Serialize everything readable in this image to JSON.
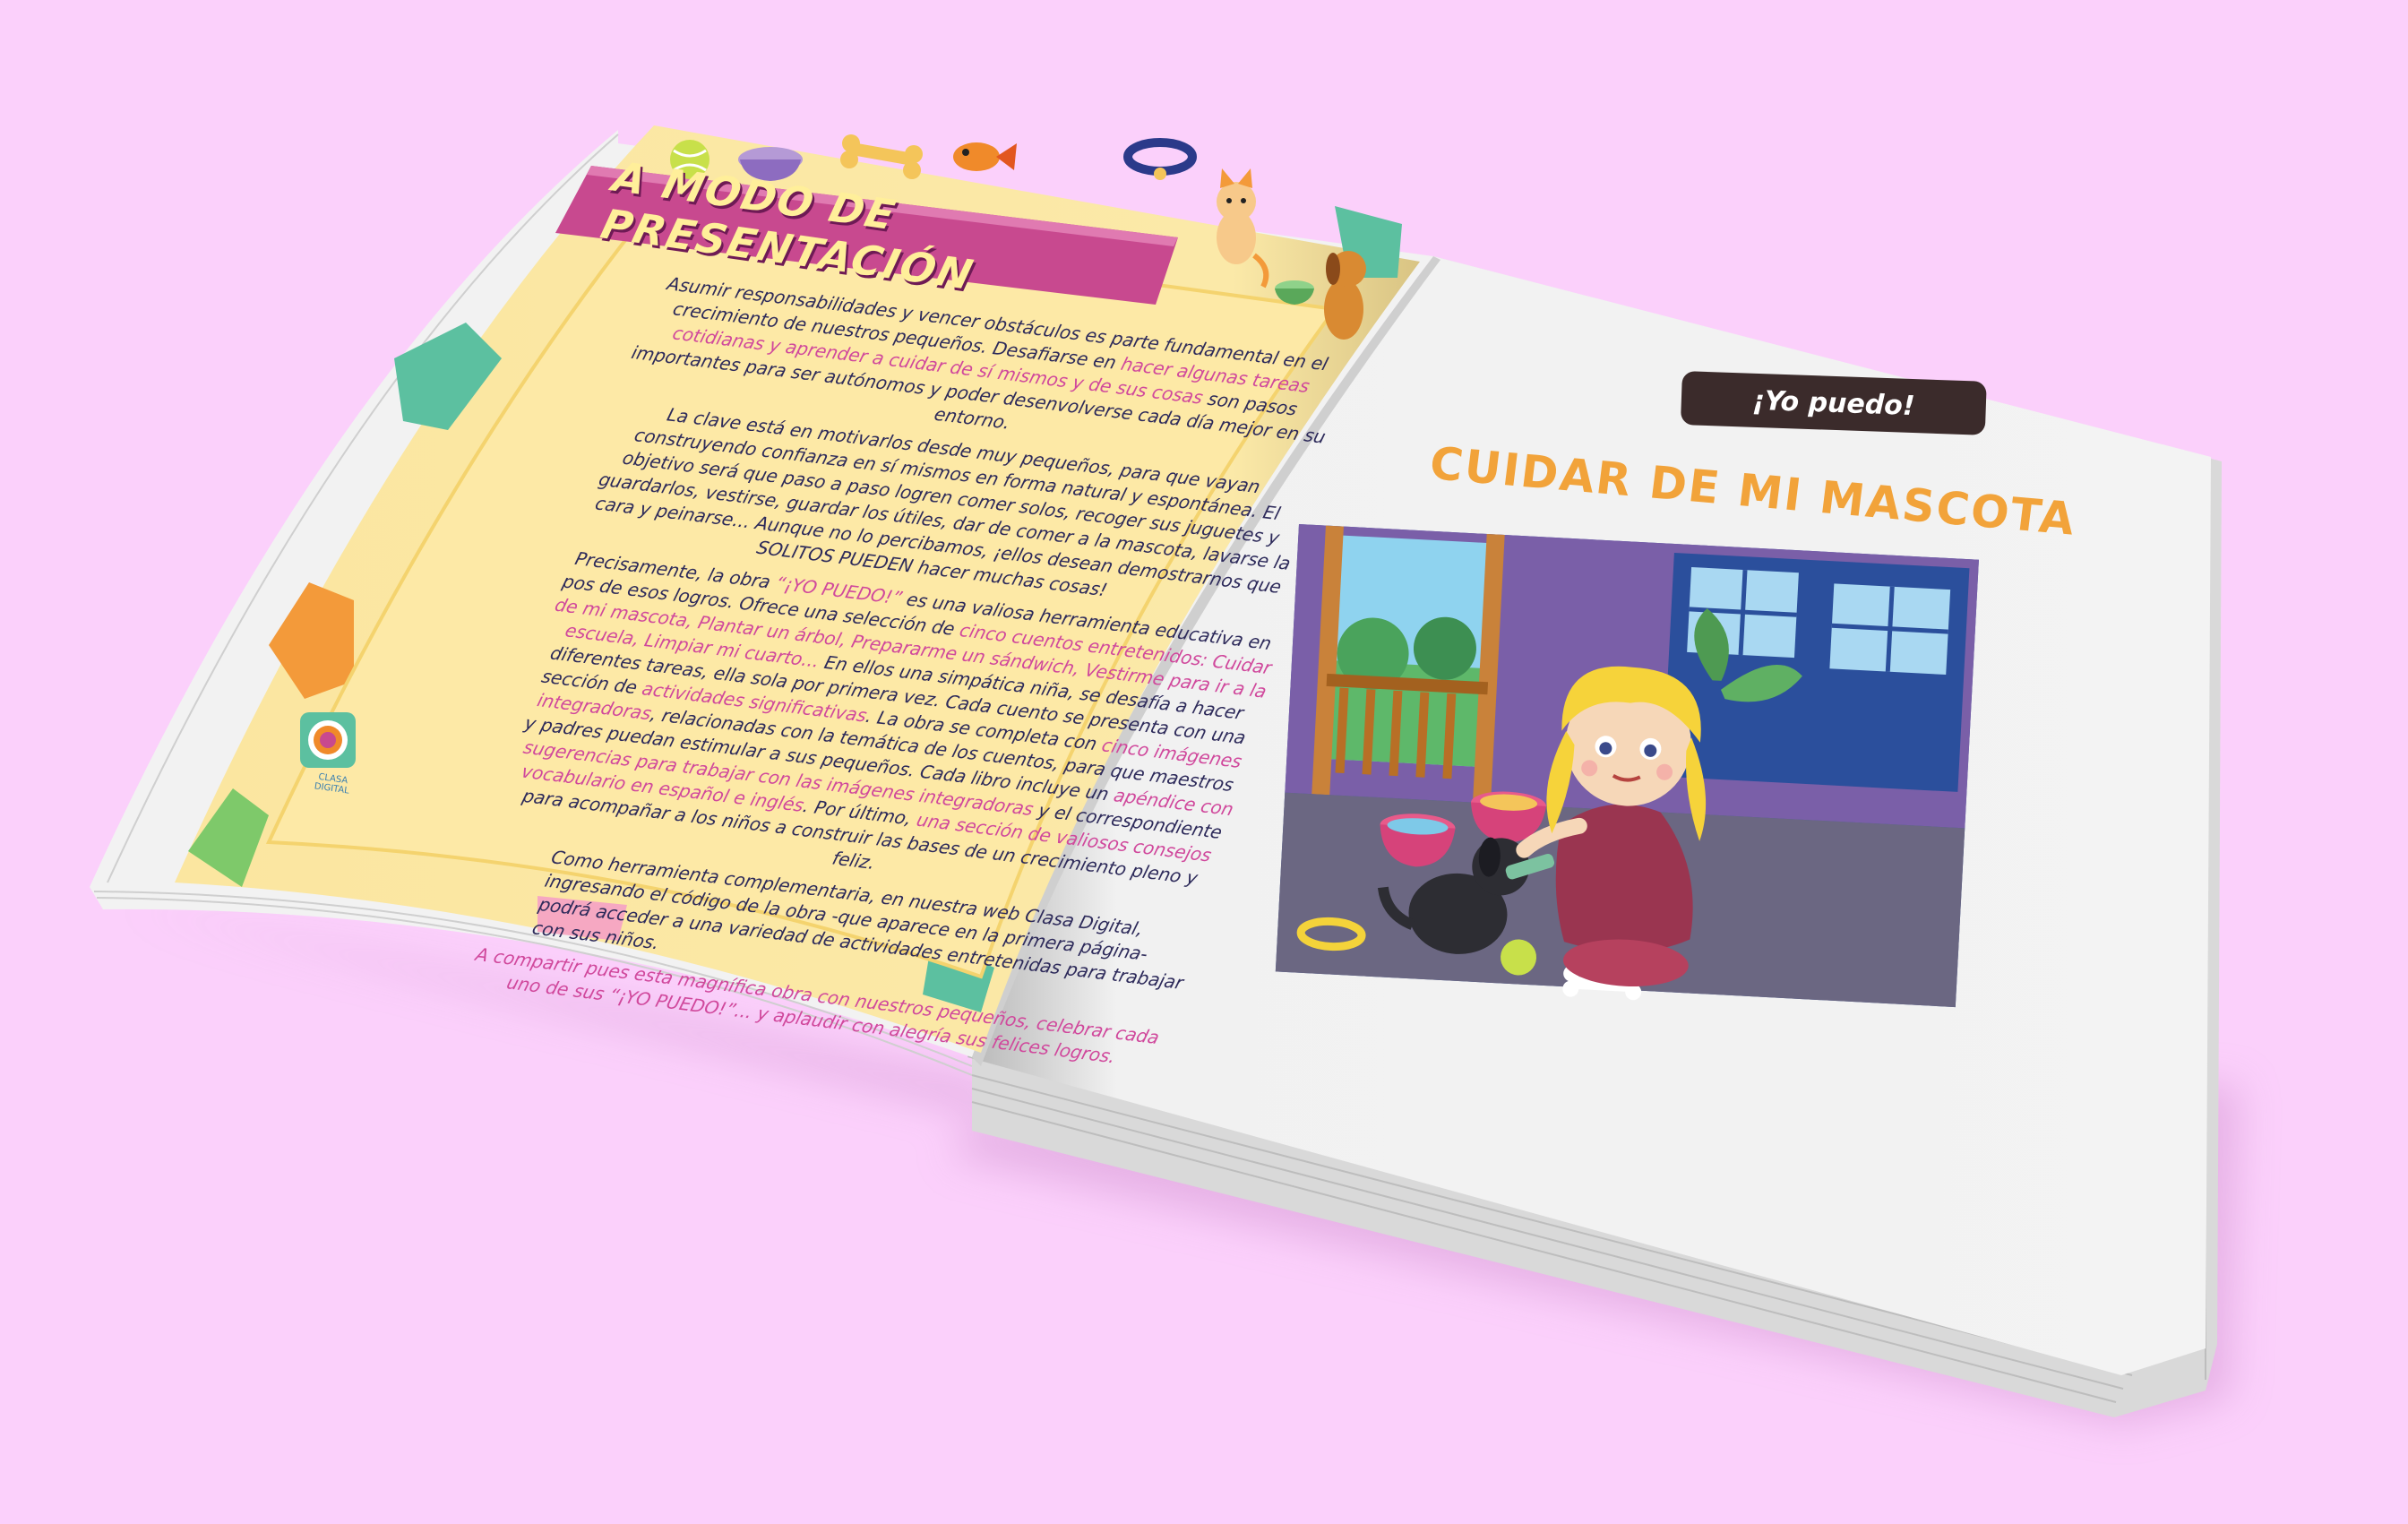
{
  "left_page": {
    "title": "A MODO DE PRESENTACIÓN",
    "paragraphs": [
      [
        {
          "text": "Asumir responsabilidades y vencer obstáculos es parte fundamental en el crecimiento de nuestros pequeños. Desafiarse en ",
          "hl": false
        },
        {
          "text": "hacer algunas tareas cotidianas y aprender a cuidar de sí mismos y de sus cosas",
          "hl": true
        },
        {
          "text": " son pasos importantes para ser autónomos y poder desenvolverse cada día mejor en su entorno.",
          "hl": false
        }
      ],
      [
        {
          "text": "La clave está en motivarlos desde muy pequeños, para que vayan construyendo confianza en sí mismos en forma natural y espontánea. El objetivo será que paso a paso logren comer solos, recoger sus juguetes y guardarlos, vestirse, guardar los útiles, dar de comer a la mascota, lavarse la cara y peinarse... Aunque no lo percibamos, ¡ellos desean demostrarnos que SOLITOS PUEDEN hacer muchas cosas!",
          "hl": false
        }
      ],
      [
        {
          "text": "Precisamente, la obra ",
          "hl": false
        },
        {
          "text": "“¡YO PUEDO!”",
          "hl": true
        },
        {
          "text": " es una valiosa herramienta educativa en pos de esos logros. Ofrece una selección de ",
          "hl": false
        },
        {
          "text": "cinco cuentos entretenidos: Cuidar de mi mascota, Plantar un árbol, Prepararme un sándwich, Vestirme para ir a la escuela, Limpiar mi cuarto...",
          "hl": true
        },
        {
          "text": " En ellos una simpática niña, se desafía a hacer diferentes tareas, ella sola por primera vez. Cada cuento se presenta con una sección de ",
          "hl": false
        },
        {
          "text": "actividades significativas",
          "hl": true
        },
        {
          "text": ". La obra se completa con ",
          "hl": false
        },
        {
          "text": "cinco imágenes integradoras",
          "hl": true
        },
        {
          "text": ", relacionadas con la temática de los cuentos, para que maestros y padres puedan estimular a sus pequeños. Cada libro incluye un ",
          "hl": false
        },
        {
          "text": "apéndice con sugerencias para trabajar con las imágenes integradoras",
          "hl": true
        },
        {
          "text": " y el correspondiente ",
          "hl": false
        },
        {
          "text": "vocabulario en español e inglés",
          "hl": true
        },
        {
          "text": ". Por último, ",
          "hl": false
        },
        {
          "text": "una sección de valiosos consejos",
          "hl": true
        },
        {
          "text": " para acompañar a los niños a construir las bases de un crecimiento pleno y feliz.",
          "hl": false
        }
      ],
      [
        {
          "text": "Como herramienta complementaria, en nuestra web Clasa Digital, ingresando el código de la obra -que aparece en la primera página- podrá acceder a una variedad de actividades entretenidas para trabajar con sus niños.",
          "hl": false
        }
      ],
      [
        {
          "text": "A compartir pues esta magnífica obra con nuestros pequeños, celebrar cada uno de sus “¡YO PUEDO!”... y aplaudir con alegría sus felices logros.",
          "hl": false
        }
      ]
    ],
    "logo_caption": "CLASA DIGITAL"
  },
  "right_page": {
    "collection_badge": "¡Yo puedo!",
    "story_title": "CUIDAR DE MI MASCOTA"
  },
  "colors": {
    "background": "#fbd0fb",
    "page_yellow": "#fbe7a0",
    "title_banner": "#c8498f",
    "highlight_text": "#d0489c",
    "body_text": "#2d2a5a",
    "story_title": "#f2a33a",
    "badge": "#3b2b2b"
  },
  "icons": [
    "tennis-ball-icon",
    "pet-bowl-icon",
    "bone-icon",
    "goldfish-icon",
    "pet-collar-icon",
    "cat-icon",
    "dog-icon",
    "web-logo-icon"
  ]
}
